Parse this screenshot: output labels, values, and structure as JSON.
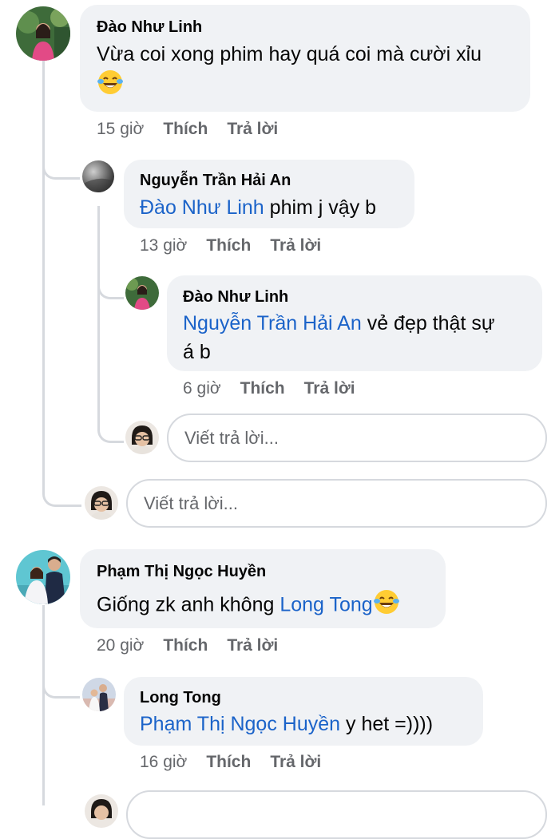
{
  "comments": [
    {
      "author": "Đào Như Linh",
      "text": "Vừa coi xong phim hay quá coi mà cười xỉu",
      "emoji": "laughing-tears-emoji",
      "time": "15 giờ",
      "like": "Thích",
      "reply": "Trả lời",
      "replies": [
        {
          "author": "Nguyễn Trần Hải An",
          "mention": "Đào Như Linh",
          "text": " phim j vậy b",
          "time": "13 giờ",
          "like": "Thích",
          "reply": "Trả lời",
          "replies": [
            {
              "author": "Đào Như Linh",
              "mention": "Nguyễn Trần Hải An",
              "text_line1": " vẻ đẹp thật sự",
              "text_line2": "á b",
              "time": "6 giờ",
              "like": "Thích",
              "reply": "Trả lời"
            }
          ],
          "reply_placeholder": "Viết trả lời..."
        }
      ],
      "reply_placeholder": "Viết trả lời..."
    },
    {
      "author": "Phạm Thị Ngọc Huyền",
      "text": "Giống zk anh không ",
      "mention": "Long Tong",
      "emoji": "laughing-tears-emoji",
      "time": "20 giờ",
      "like": "Thích",
      "reply": "Trả lời",
      "replies": [
        {
          "author": "Long Tong",
          "mention": "Phạm Thị Ngọc Huyền",
          "text": " y het =))))",
          "time": "16 giờ",
          "like": "Thích",
          "reply": "Trả lời"
        }
      ]
    }
  ],
  "colors": {
    "bubble": "#f0f2f5",
    "mention": "#1b63c9",
    "meta": "#65676b",
    "thread_line": "#d6d9de"
  }
}
